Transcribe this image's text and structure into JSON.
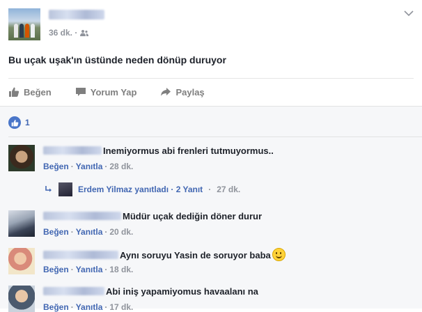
{
  "post": {
    "time": "36 dk.",
    "separator": "·",
    "text": "Bu uçak uşak'ın üstünde neden dönüp duruyor",
    "actions": {
      "like": "Beğen",
      "comment": "Yorum Yap",
      "share": "Paylaş"
    }
  },
  "reactions": {
    "count": "1"
  },
  "comments": [
    {
      "text": "Inemiyormus abi frenleri tutmuyormus..",
      "like": "Beğen",
      "reply": "Yanıtla",
      "time": "28 dk."
    },
    {
      "text": "Müdür uçak dediğin döner durur",
      "like": "Beğen",
      "reply": "Yanıtla",
      "time": "20 dk."
    },
    {
      "text": "Aynı soruyu Yasin de soruyor baba",
      "like": "Beğen",
      "reply": "Yanıtla",
      "time": "18 dk."
    },
    {
      "text": "Abi iniş yapamiyomus havaalanı na",
      "like": "Beğen",
      "reply": "Yanıtla",
      "time": "17 dk."
    }
  ],
  "reply_summary": {
    "text": "Erdem Yilmaz yanıtladı · 2 Yanıt",
    "time": "27 dk."
  },
  "colors": {
    "link": "#4267b2",
    "muted": "#90949c",
    "comments_bg": "#f6f7f9"
  }
}
